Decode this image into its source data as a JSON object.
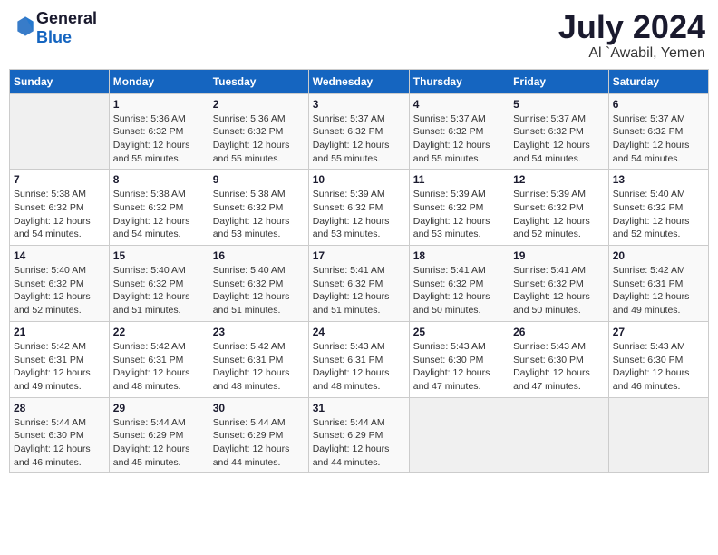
{
  "header": {
    "logo_general": "General",
    "logo_blue": "Blue",
    "month": "July 2024",
    "location": "Al `Awabil, Yemen"
  },
  "weekdays": [
    "Sunday",
    "Monday",
    "Tuesday",
    "Wednesday",
    "Thursday",
    "Friday",
    "Saturday"
  ],
  "weeks": [
    [
      {
        "day": "",
        "info": ""
      },
      {
        "day": "1",
        "info": "Sunrise: 5:36 AM\nSunset: 6:32 PM\nDaylight: 12 hours\nand 55 minutes."
      },
      {
        "day": "2",
        "info": "Sunrise: 5:36 AM\nSunset: 6:32 PM\nDaylight: 12 hours\nand 55 minutes."
      },
      {
        "day": "3",
        "info": "Sunrise: 5:37 AM\nSunset: 6:32 PM\nDaylight: 12 hours\nand 55 minutes."
      },
      {
        "day": "4",
        "info": "Sunrise: 5:37 AM\nSunset: 6:32 PM\nDaylight: 12 hours\nand 55 minutes."
      },
      {
        "day": "5",
        "info": "Sunrise: 5:37 AM\nSunset: 6:32 PM\nDaylight: 12 hours\nand 54 minutes."
      },
      {
        "day": "6",
        "info": "Sunrise: 5:37 AM\nSunset: 6:32 PM\nDaylight: 12 hours\nand 54 minutes."
      }
    ],
    [
      {
        "day": "7",
        "info": "Sunrise: 5:38 AM\nSunset: 6:32 PM\nDaylight: 12 hours\nand 54 minutes."
      },
      {
        "day": "8",
        "info": "Sunrise: 5:38 AM\nSunset: 6:32 PM\nDaylight: 12 hours\nand 54 minutes."
      },
      {
        "day": "9",
        "info": "Sunrise: 5:38 AM\nSunset: 6:32 PM\nDaylight: 12 hours\nand 53 minutes."
      },
      {
        "day": "10",
        "info": "Sunrise: 5:39 AM\nSunset: 6:32 PM\nDaylight: 12 hours\nand 53 minutes."
      },
      {
        "day": "11",
        "info": "Sunrise: 5:39 AM\nSunset: 6:32 PM\nDaylight: 12 hours\nand 53 minutes."
      },
      {
        "day": "12",
        "info": "Sunrise: 5:39 AM\nSunset: 6:32 PM\nDaylight: 12 hours\nand 52 minutes."
      },
      {
        "day": "13",
        "info": "Sunrise: 5:40 AM\nSunset: 6:32 PM\nDaylight: 12 hours\nand 52 minutes."
      }
    ],
    [
      {
        "day": "14",
        "info": "Sunrise: 5:40 AM\nSunset: 6:32 PM\nDaylight: 12 hours\nand 52 minutes."
      },
      {
        "day": "15",
        "info": "Sunrise: 5:40 AM\nSunset: 6:32 PM\nDaylight: 12 hours\nand 51 minutes."
      },
      {
        "day": "16",
        "info": "Sunrise: 5:40 AM\nSunset: 6:32 PM\nDaylight: 12 hours\nand 51 minutes."
      },
      {
        "day": "17",
        "info": "Sunrise: 5:41 AM\nSunset: 6:32 PM\nDaylight: 12 hours\nand 51 minutes."
      },
      {
        "day": "18",
        "info": "Sunrise: 5:41 AM\nSunset: 6:32 PM\nDaylight: 12 hours\nand 50 minutes."
      },
      {
        "day": "19",
        "info": "Sunrise: 5:41 AM\nSunset: 6:32 PM\nDaylight: 12 hours\nand 50 minutes."
      },
      {
        "day": "20",
        "info": "Sunrise: 5:42 AM\nSunset: 6:31 PM\nDaylight: 12 hours\nand 49 minutes."
      }
    ],
    [
      {
        "day": "21",
        "info": "Sunrise: 5:42 AM\nSunset: 6:31 PM\nDaylight: 12 hours\nand 49 minutes."
      },
      {
        "day": "22",
        "info": "Sunrise: 5:42 AM\nSunset: 6:31 PM\nDaylight: 12 hours\nand 48 minutes."
      },
      {
        "day": "23",
        "info": "Sunrise: 5:42 AM\nSunset: 6:31 PM\nDaylight: 12 hours\nand 48 minutes."
      },
      {
        "day": "24",
        "info": "Sunrise: 5:43 AM\nSunset: 6:31 PM\nDaylight: 12 hours\nand 48 minutes."
      },
      {
        "day": "25",
        "info": "Sunrise: 5:43 AM\nSunset: 6:30 PM\nDaylight: 12 hours\nand 47 minutes."
      },
      {
        "day": "26",
        "info": "Sunrise: 5:43 AM\nSunset: 6:30 PM\nDaylight: 12 hours\nand 47 minutes."
      },
      {
        "day": "27",
        "info": "Sunrise: 5:43 AM\nSunset: 6:30 PM\nDaylight: 12 hours\nand 46 minutes."
      }
    ],
    [
      {
        "day": "28",
        "info": "Sunrise: 5:44 AM\nSunset: 6:30 PM\nDaylight: 12 hours\nand 46 minutes."
      },
      {
        "day": "29",
        "info": "Sunrise: 5:44 AM\nSunset: 6:29 PM\nDaylight: 12 hours\nand 45 minutes."
      },
      {
        "day": "30",
        "info": "Sunrise: 5:44 AM\nSunset: 6:29 PM\nDaylight: 12 hours\nand 44 minutes."
      },
      {
        "day": "31",
        "info": "Sunrise: 5:44 AM\nSunset: 6:29 PM\nDaylight: 12 hours\nand 44 minutes."
      },
      {
        "day": "",
        "info": ""
      },
      {
        "day": "",
        "info": ""
      },
      {
        "day": "",
        "info": ""
      }
    ]
  ]
}
